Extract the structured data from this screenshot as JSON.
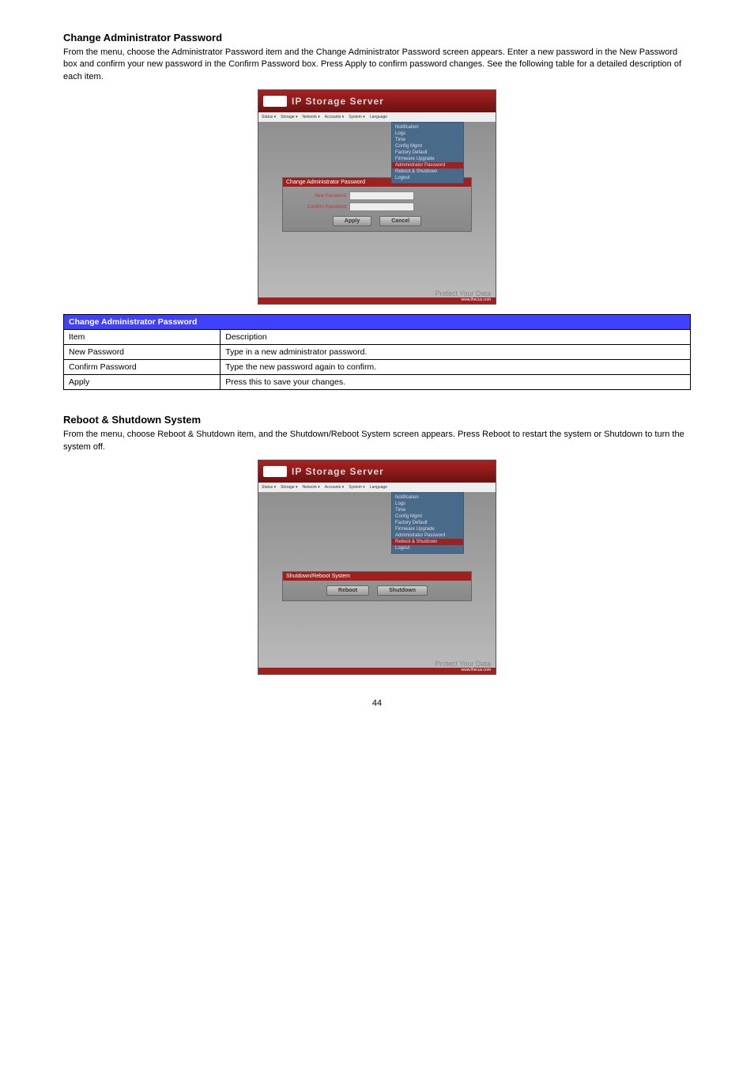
{
  "section1": {
    "title": "Change Administrator Password",
    "text": "From the menu, choose the Administrator Password item and the Change Administrator Password screen appears. Enter a new password in the New Password box and confirm your new password in the Confirm Password box. Press Apply to confirm password changes. See the following table for a detailed description of each item."
  },
  "ss1": {
    "brand": "IP Storage Server",
    "menubar": [
      "Status ▾",
      "Storage ▾",
      "Network ▾",
      "Accounts ▾",
      "System ▾",
      "Language"
    ],
    "dropdown": [
      "Notification",
      "Logs",
      "Time",
      "Config Mgmt",
      "Factory Default",
      "Firmware Upgrade",
      "Administrator Password",
      "Reboot & Shutdown",
      "Logout"
    ],
    "dropdown_active_index": 6,
    "panel_title": "Change Administrator Password",
    "row1_label": "New Password",
    "row2_label": "Confirm Password",
    "apply": "Apply",
    "cancel": "Cancel",
    "footer_logo": "Protect Your Data",
    "footer_bar": "www.thecus.com"
  },
  "table1": {
    "header_left": "Change Administrator Password",
    "header_right": "",
    "rows": [
      {
        "item": "Item",
        "desc": "Description"
      },
      {
        "item": "New Password",
        "desc": "Type in a new administrator password."
      },
      {
        "item": "Confirm Password",
        "desc": "Type the new password again to confirm."
      },
      {
        "item": "Apply",
        "desc": "Press this to save your changes."
      }
    ]
  },
  "section2": {
    "title": "Reboot & Shutdown System",
    "text": "From the menu, choose Reboot & Shutdown item, and the Shutdown/Reboot System screen appears. Press Reboot to restart the system or Shutdown to turn the system off."
  },
  "ss2": {
    "brand": "IP Storage Server",
    "menubar": [
      "Status ▾",
      "Storage ▾",
      "Network ▾",
      "Accounts ▾",
      "System ▾",
      "Language"
    ],
    "dropdown": [
      "Notification",
      "Logs",
      "Time",
      "Config Mgmt",
      "Factory Default",
      "Firmware Upgrade",
      "Administrator Password",
      "Reboot & Shutdown",
      "Logout"
    ],
    "dropdown_active_index": 7,
    "panel_title": "Shutdown/Reboot System",
    "reboot": "Reboot",
    "shutdown": "Shutdown",
    "footer_logo": "Protect Your Data",
    "footer_bar": "www.thecus.com"
  },
  "page_number": "44"
}
